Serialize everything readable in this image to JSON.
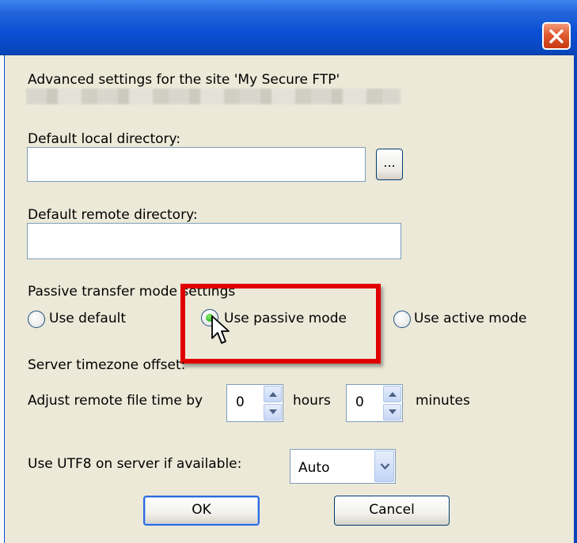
{
  "window": {
    "title": "",
    "close_icon": "close-icon",
    "colors": {
      "titlebar": "#0a4fd3",
      "close_button": "#e05a30",
      "dialog_bg": "#ece9d8",
      "highlight": "#e00000"
    }
  },
  "header": {
    "site_label": "Advanced settings for the site 'My Secure FTP'"
  },
  "local_dir": {
    "label": "Default local directory:",
    "value": "",
    "browse_label": "..."
  },
  "remote_dir": {
    "label": "Default remote directory:",
    "value": ""
  },
  "passive": {
    "label": "Passive transfer mode settings",
    "options": [
      {
        "label": "Use default",
        "selected": false
      },
      {
        "label": "Use passive mode",
        "selected": true
      },
      {
        "label": "Use active mode",
        "selected": false
      }
    ]
  },
  "timezone": {
    "label": "Server timezone offset:",
    "adjust_label": "Adjust remote file time by",
    "hours_value": "0",
    "hours_label": "hours",
    "minutes_value": "0",
    "minutes_label": "minutes"
  },
  "utf8": {
    "label": "Use UTF8 on server if available:",
    "selected": "Auto"
  },
  "buttons": {
    "ok": "OK",
    "cancel": "Cancel"
  }
}
